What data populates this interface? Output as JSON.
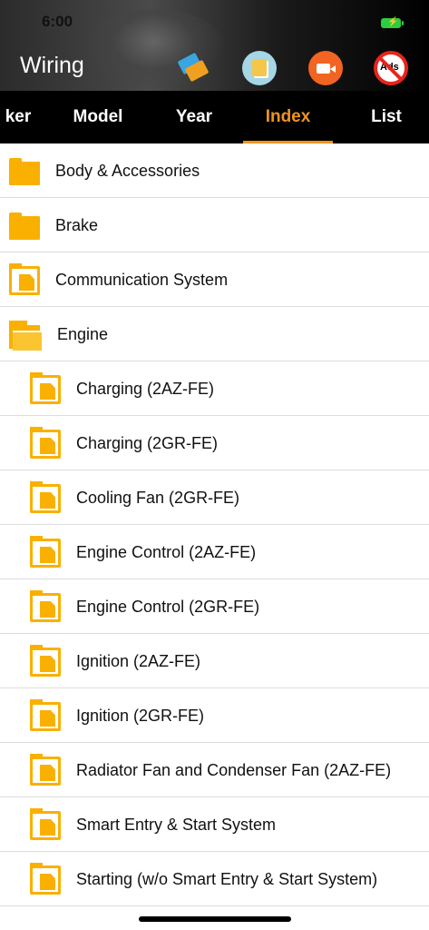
{
  "status": {
    "time": "6:00",
    "battery_icon": "battery-charging-icon"
  },
  "header": {
    "title": "Wiring",
    "icons": [
      "tag-icon",
      "book-icon",
      "video-camera-icon",
      "no-ads-icon"
    ],
    "ads_text": "Ads"
  },
  "tabs": [
    {
      "label": "ker",
      "active": false
    },
    {
      "label": "Model",
      "active": false
    },
    {
      "label": "Year",
      "active": false
    },
    {
      "label": "Index",
      "active": true
    },
    {
      "label": "List",
      "active": false
    }
  ],
  "colors": {
    "accent": "#f0941e",
    "folder": "#f9b000",
    "tab_bar": "#000000"
  },
  "items": [
    {
      "label": "Body & Accessories",
      "icon": "folder-icon"
    },
    {
      "label": "Brake",
      "icon": "folder-icon"
    },
    {
      "label": "Communication System",
      "icon": "document-folder-icon"
    },
    {
      "label": "Engine",
      "icon": "folder-open-icon"
    },
    {
      "label": "Charging (2AZ-FE)",
      "icon": "document-folder-icon"
    },
    {
      "label": "Charging (2GR-FE)",
      "icon": "document-folder-icon"
    },
    {
      "label": "Cooling Fan (2GR-FE)",
      "icon": "document-folder-icon"
    },
    {
      "label": "Engine Control (2AZ-FE)",
      "icon": "document-folder-icon"
    },
    {
      "label": "Engine Control (2GR-FE)",
      "icon": "document-folder-icon"
    },
    {
      "label": "Ignition (2AZ-FE)",
      "icon": "document-folder-icon"
    },
    {
      "label": "Ignition (2GR-FE)",
      "icon": "document-folder-icon"
    },
    {
      "label": "Radiator Fan and Condenser Fan (2AZ-FE)",
      "icon": "document-folder-icon"
    },
    {
      "label": "Smart Entry & Start System",
      "icon": "document-folder-icon"
    },
    {
      "label": "Starting (w/o Smart Entry & Start System)",
      "icon": "document-folder-icon"
    }
  ]
}
